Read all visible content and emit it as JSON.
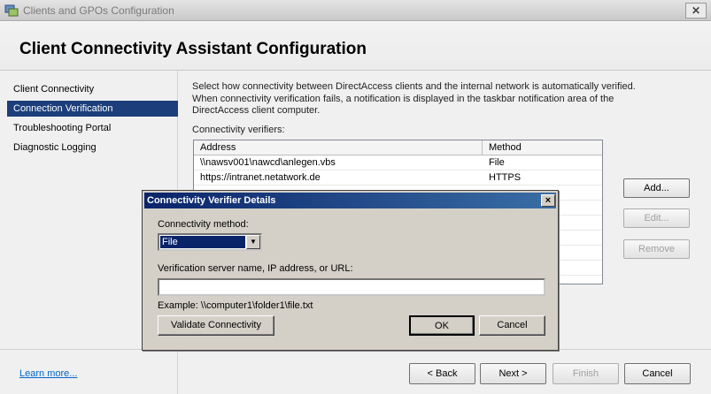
{
  "window": {
    "title": "Clients and GPOs Configuration",
    "close_glyph": "✕"
  },
  "header": {
    "title": "Client Connectivity Assistant Configuration"
  },
  "sidebar": {
    "items": [
      {
        "label": "Client Connectivity",
        "selected": false
      },
      {
        "label": "Connection Verification",
        "selected": true
      },
      {
        "label": "Troubleshooting Portal",
        "selected": false
      },
      {
        "label": "Diagnostic Logging",
        "selected": false
      }
    ]
  },
  "main": {
    "description": "Select how connectivity between DirectAccess clients and the internal network is automatically verified. When connectivity verification fails, a notification is displayed in the taskbar notification area of the DirectAccess client computer.",
    "verifiers_label": "Connectivity verifiers:",
    "table": {
      "columns": [
        "Address",
        "Method"
      ],
      "rows": [
        {
          "address": "\\\\nawsv001\\nawcd\\anlegen.vbs",
          "method": "File"
        },
        {
          "address": "https://intranet.netatwork.de",
          "method": "HTTPS"
        }
      ]
    },
    "buttons": {
      "add": "Add...",
      "edit": "Edit...",
      "remove": "Remove"
    }
  },
  "footer": {
    "learn_more": "Learn more...",
    "back": "< Back",
    "next": "Next >",
    "finish": "Finish",
    "cancel": "Cancel"
  },
  "dialog": {
    "title": "Connectivity Verifier Details",
    "close_glyph": "×",
    "method_label": "Connectivity method:",
    "method_value": "File",
    "server_label": "Verification server name, IP address, or URL:",
    "server_value": "",
    "example": "Example: \\\\computer1\\folder1\\file.txt",
    "validate_button": "Validate Connectivity",
    "ok_button": "OK",
    "cancel_button": "Cancel"
  },
  "colors": {
    "selection": "#1c3f7b",
    "dialog_title": "#0a246a",
    "link": "#0066cc"
  }
}
